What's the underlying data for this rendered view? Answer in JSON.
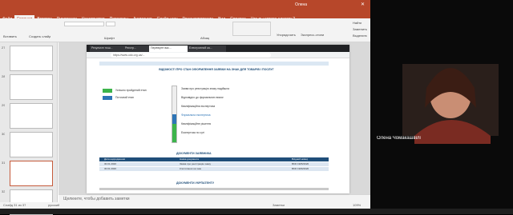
{
  "window": {
    "title": "Файл Главная Вставка Конструктор Переходы Анимация Слайд-шоу Рецензирование Вид Справка",
    "user": "Олена"
  },
  "tabs": [
    {
      "label": "Файл"
    },
    {
      "label": "Главная"
    },
    {
      "label": "Вставка"
    },
    {
      "label": "Рисование"
    },
    {
      "label": "Конструктор"
    },
    {
      "label": "Переходы"
    },
    {
      "label": "Анимация"
    },
    {
      "label": "Слайд-шоу"
    },
    {
      "label": "Рецензирование"
    },
    {
      "label": "Вид"
    },
    {
      "label": "Справка"
    },
    {
      "label": "Что вы хотите сделать?"
    }
  ],
  "ribbon": {
    "paste": "Вставить",
    "create_slide": "Создать слайд",
    "font_group": "Шрифт",
    "paragraph_group": "Абзац",
    "arrange": "Упорядочить",
    "styles": "Экспресс-стили",
    "find": "Найти",
    "replace": "Заменить",
    "select": "Выделить"
  },
  "thumbnails": [
    {
      "num": "27"
    },
    {
      "num": "28"
    },
    {
      "num": "29"
    },
    {
      "num": "30"
    },
    {
      "num": "31"
    },
    {
      "num": "32"
    }
  ],
  "slide": {
    "browser_tabs": [
      {
        "label": "Результат пош..."
      },
      {
        "label": "Реєстр..."
      },
      {
        "label": "Перевірте вас..."
      },
      {
        "label": "Електронний ка..."
      }
    ],
    "url": "https://www.udo.org.ua/...",
    "doc_title": "ВІДОМОСТІ ПРО СТАН ОФОРМЛЕННЯ ЗАЯВКИ НА ЗНАК ДЛЯ ТОВАРІВ І ПОСЛУГ",
    "legend1": "Успішно пройдений етап",
    "legend2": "Поточний етап",
    "stages": [
      "Заява про реєстрацію знаку надійшла",
      "Відповідно до формальних вимог",
      "Кваліфікаційна експертиза",
      "Формальна експертиза",
      "Кваліфікаційне рішення",
      "Експертиза по суті"
    ],
    "docs_title": "ДОКУМЕНТИ ЗАЯВНИКА",
    "docs_cols": [
      "Дата надходження",
      "Назва документа",
      "Вхідний номер"
    ],
    "docs_rows": [
      [
        "30.01.2020",
        "Заява про реєстрацію знаку",
        "BKD 1905/2020"
      ],
      [
        "30.01.2020",
        "Клопотання на знак",
        "BKD 1906/2020"
      ]
    ],
    "docs_title2": "ДОКУМЕНТИ УКРПАТЕНТУ"
  },
  "notes_placeholder": "Щелкните, чтобы добавить заметки",
  "status": {
    "slide": "Слайд 31 из 37",
    "language": "русский",
    "notes": "Заметки",
    "zoom": "109%"
  },
  "webcam": {
    "name": "Олена Чомакашвілі"
  }
}
